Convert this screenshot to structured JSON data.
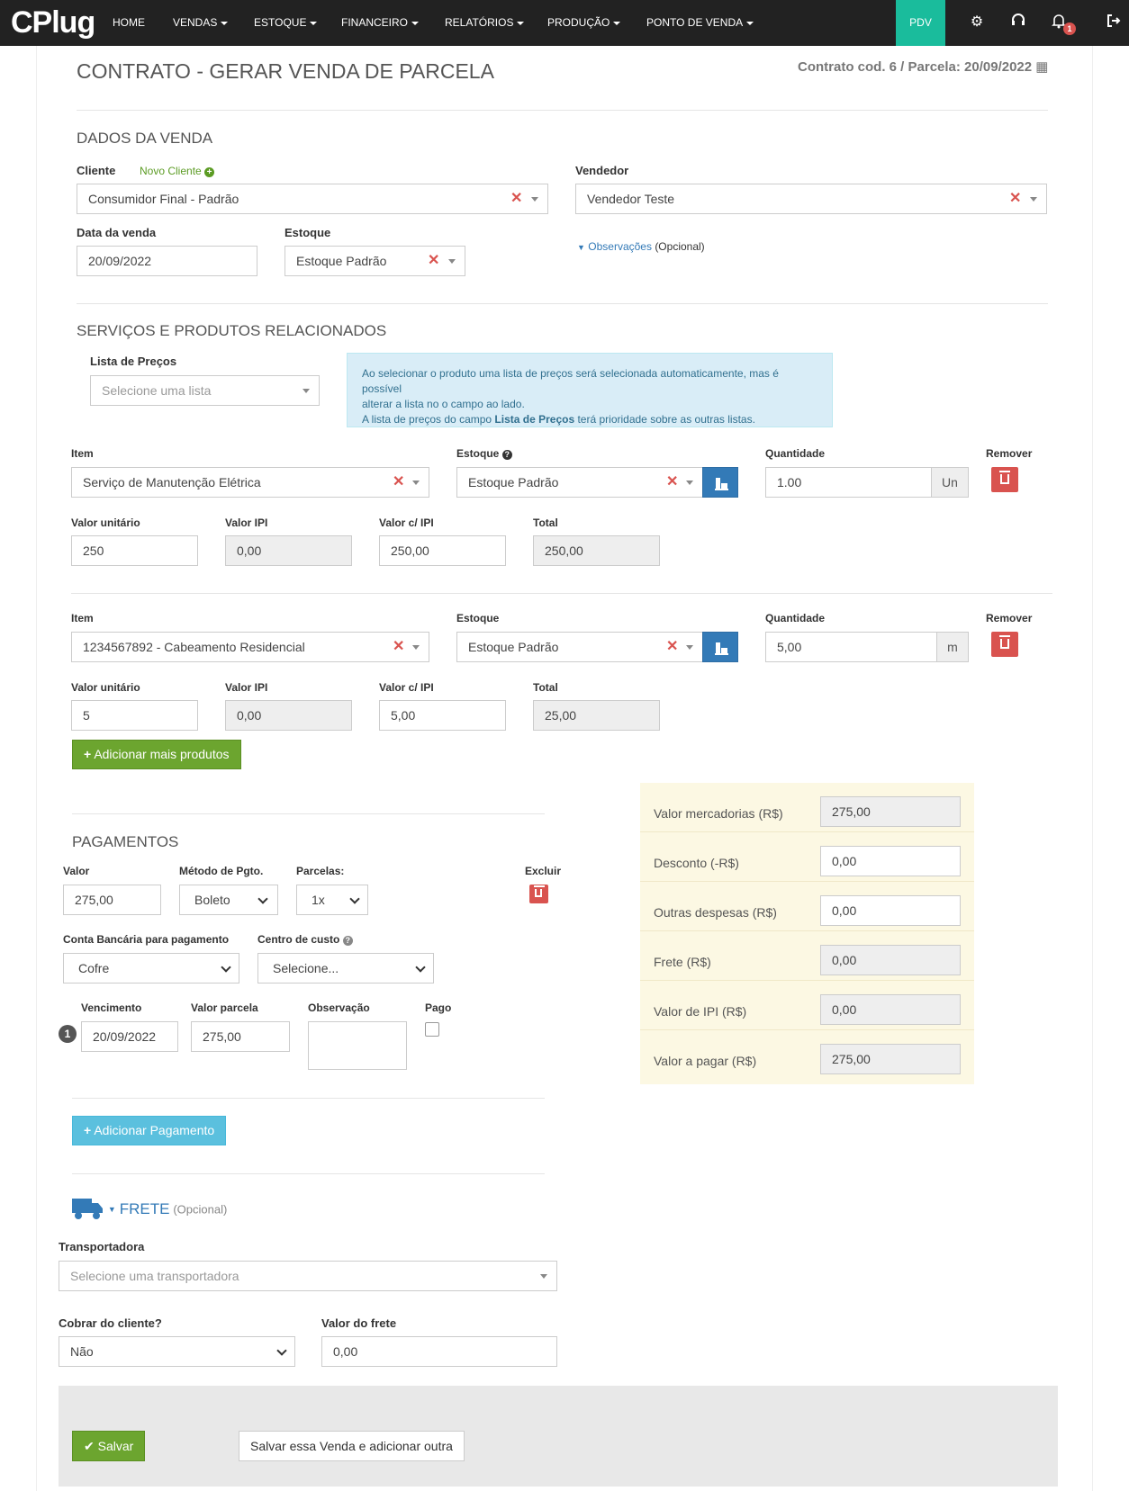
{
  "nav": {
    "logo": "CPlug",
    "items": [
      "HOME",
      "VENDAS",
      "ESTOQUE",
      "FINANCEIRO",
      "RELATÓRIOS",
      "PRODUÇÃO",
      "PONTO DE VENDA"
    ],
    "pdv": "PDV",
    "notif_count": "1"
  },
  "page": {
    "title": "CONTRATO - GERAR VENDA DE PARCELA",
    "contract_info": "Contrato cod. 6 / Parcela: 20/09/2022"
  },
  "sale": {
    "heading": "DADOS DA VENDA",
    "client_label": "Cliente",
    "new_client": "Novo Cliente",
    "client_value": "Consumidor Final - Padrão",
    "seller_label": "Vendedor",
    "seller_value": "Vendedor Teste",
    "date_label": "Data da venda",
    "date_value": "20/09/2022",
    "stock_label": "Estoque",
    "stock_value": "Estoque Padrão",
    "obs_link": "Observações",
    "obs_optional": "(Opcional)"
  },
  "products": {
    "heading": "SERVIÇOS E PRODUTOS RELACIONADOS",
    "pricelist_label": "Lista de Preços",
    "pricelist_placeholder": "Selecione uma lista",
    "info_line1": "Ao selecionar o produto uma lista de preços será selecionada automaticamente, mas é possível",
    "info_line2": "alterar a lista no o campo ao lado.",
    "info_line3a": "A lista de preços do campo ",
    "info_line3b": "Lista de Preços",
    "info_line3c": " terá prioridade sobre as outras listas.",
    "labels": {
      "item": "Item",
      "stock": "Estoque",
      "qty": "Quantidade",
      "remove": "Remover",
      "unit": "Valor unitário",
      "ipi": "Valor IPI",
      "with_ipi": "Valor c/ IPI",
      "total": "Total"
    },
    "rows": [
      {
        "item": "Serviço de Manutenção Elétrica",
        "stock": "Estoque Padrão",
        "qty": "1.00",
        "unit_abbr": "Un",
        "unit_value": "250",
        "ipi": "0,00",
        "with_ipi": "250,00",
        "total": "250,00"
      },
      {
        "item": "1234567892 - Cabeamento Residencial",
        "stock": "Estoque Padrão",
        "qty": "5,00",
        "unit_abbr": "m",
        "unit_value": "5",
        "ipi": "0,00",
        "with_ipi": "5,00",
        "total": "25,00"
      }
    ],
    "add_button": "Adicionar mais produtos"
  },
  "summary": {
    "rows": [
      {
        "label": "Valor mercadorias (R$)",
        "value": "275,00"
      },
      {
        "label": "Desconto (-R$)",
        "value": "0,00"
      },
      {
        "label": "Outras despesas (R$)",
        "value": "0,00"
      },
      {
        "label": "Frete (R$)",
        "value": "0,00"
      },
      {
        "label": "Valor de IPI (R$)",
        "value": "0,00"
      },
      {
        "label": "Valor a pagar (R$)",
        "value": "275,00"
      }
    ]
  },
  "payments": {
    "heading": "PAGAMENTOS",
    "value_label": "Valor",
    "value": "275,00",
    "method_label": "Método de Pgto.",
    "method": "Boleto",
    "installments_label": "Parcelas:",
    "installments": "1x",
    "delete_label": "Excluir",
    "account_label": "Conta Bancária para pagamento",
    "account": "Cofre",
    "cost_center_label": "Centro de custo",
    "cost_center": "Selecione...",
    "due_label": "Vencimento",
    "amount_label": "Valor parcela",
    "obs_label": "Observação",
    "paid_label": "Pago",
    "installment_number": "1",
    "due": "20/09/2022",
    "amount": "275,00",
    "add_button": "Adicionar Pagamento"
  },
  "freight": {
    "heading": "FRETE",
    "optional": "(Opcional)",
    "carrier_label": "Transportadora",
    "carrier_placeholder": "Selecione uma transportadora",
    "charge_label": "Cobrar do cliente?",
    "charge_value": "Não",
    "value_label": "Valor do frete",
    "value": "0,00"
  },
  "footer": {
    "save": "Salvar",
    "save_another": "Salvar essa Venda e adicionar outra"
  }
}
